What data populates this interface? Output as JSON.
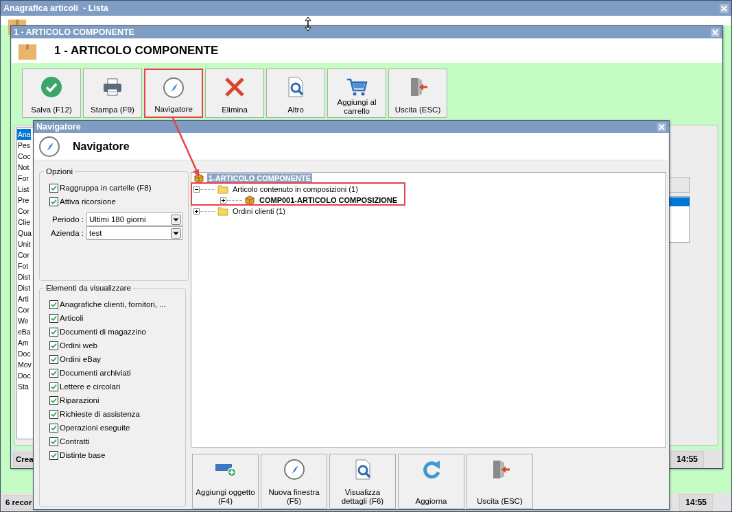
{
  "main_window": {
    "title": "Anagrafica articoli  - Lista",
    "status_text": "6 recor",
    "clock": "14:55"
  },
  "article_window": {
    "title": "1 - ARTICOLO COMPONENTE",
    "heading": "1 - ARTICOLO COMPONENTE",
    "toolbar": [
      {
        "label": "Salva (F12)",
        "kind": "save",
        "highlighted": false
      },
      {
        "label": "Stampa (F9)",
        "kind": "print",
        "highlighted": false
      },
      {
        "label": "Navigatore",
        "kind": "compass",
        "highlighted": true
      },
      {
        "label": "Elimina",
        "kind": "delete",
        "highlighted": false
      },
      {
        "label": "Altro",
        "kind": "search-doc",
        "highlighted": false
      },
      {
        "label": "Aggiungi al carrello",
        "kind": "cart",
        "highlighted": false
      },
      {
        "label": "Uscita (ESC)",
        "kind": "exit",
        "highlighted": false
      }
    ],
    "list_items": [
      {
        "label": "Ana",
        "selected": true
      },
      {
        "label": "Pes",
        "selected": false
      },
      {
        "label": "Coc",
        "selected": false
      },
      {
        "label": "Not",
        "selected": false
      },
      {
        "label": "For",
        "selected": false
      },
      {
        "label": "List",
        "selected": false
      },
      {
        "label": "Pre",
        "selected": false
      },
      {
        "label": "Cor",
        "selected": false
      },
      {
        "label": "Clie",
        "selected": false
      },
      {
        "label": "Qua",
        "selected": false
      },
      {
        "label": "Unit",
        "selected": false
      },
      {
        "label": "Cor",
        "selected": false
      },
      {
        "label": "Fot",
        "selected": false
      },
      {
        "label": "Dist",
        "selected": false
      },
      {
        "label": "Dist",
        "selected": false
      },
      {
        "label": "Arti",
        "selected": false
      },
      {
        "label": "Cor",
        "selected": false
      },
      {
        "label": "We",
        "selected": false
      },
      {
        "label": "eBa",
        "selected": false
      },
      {
        "label": "Am",
        "selected": false
      },
      {
        "label": "Doc",
        "selected": false
      },
      {
        "label": "Mov",
        "selected": false
      },
      {
        "label": "Doc",
        "selected": false
      },
      {
        "label": "Sta",
        "selected": false
      }
    ],
    "status_text": "Crea",
    "clock": "14:55"
  },
  "navigator": {
    "title": "Navigatore",
    "heading": "Navigatore",
    "options": {
      "legend": "Opzioni",
      "checks": [
        {
          "label": "Raggruppa in cartelle (F8)",
          "checked": true
        },
        {
          "label": "Attiva ricorsione",
          "checked": true
        }
      ],
      "fields": [
        {
          "label": "Periodo :",
          "value": "Ultimi 180 giorni"
        },
        {
          "label": "Azienda :",
          "value": "test"
        }
      ]
    },
    "elements": {
      "legend": "Elementi da visualizzare",
      "items": [
        {
          "label": "Anagrafiche clienti, fornitori, ...",
          "checked": true
        },
        {
          "label": "Articoli",
          "checked": true
        },
        {
          "label": "Documenti di magazzino",
          "checked": true
        },
        {
          "label": "Ordini web",
          "checked": true
        },
        {
          "label": "Ordini eBay",
          "checked": true
        },
        {
          "label": "Documenti archiviati",
          "checked": true
        },
        {
          "label": "Lettere e circolari",
          "checked": true
        },
        {
          "label": "Riparazioni",
          "checked": true
        },
        {
          "label": "Richieste di assistenza",
          "checked": true
        },
        {
          "label": "Operazioni eseguite",
          "checked": true
        },
        {
          "label": "Contratti",
          "checked": true
        },
        {
          "label": "Distinte base",
          "checked": true
        }
      ]
    },
    "tree": {
      "label": "1-ARTICOLO COMPONENTE",
      "kind": "item",
      "selected": true,
      "emphasized": true,
      "children": [
        {
          "label": "Articolo contenuto in composizioni (1)",
          "kind": "folder",
          "selected": false,
          "emphasized": false,
          "expanded": true,
          "children": [
            {
              "label": "COMP001-ARTICOLO COMPOSIZIONE",
              "kind": "item",
              "selected": false,
              "emphasized": true,
              "expanded": false
            }
          ]
        },
        {
          "label": "Ordini clienti (1)",
          "kind": "folder",
          "selected": false,
          "emphasized": false,
          "expanded": false
        }
      ]
    },
    "buttons": [
      {
        "label": "Aggiungi oggetto (F4)",
        "kind": "add"
      },
      {
        "label": "Nuova finestra (F5)",
        "kind": "compass"
      },
      {
        "label": "Visualizza dettagli (F6)",
        "kind": "search-doc"
      },
      {
        "label": "Aggiorna",
        "kind": "refresh"
      },
      {
        "label": "Uscita (ESC)",
        "kind": "exit"
      }
    ]
  }
}
